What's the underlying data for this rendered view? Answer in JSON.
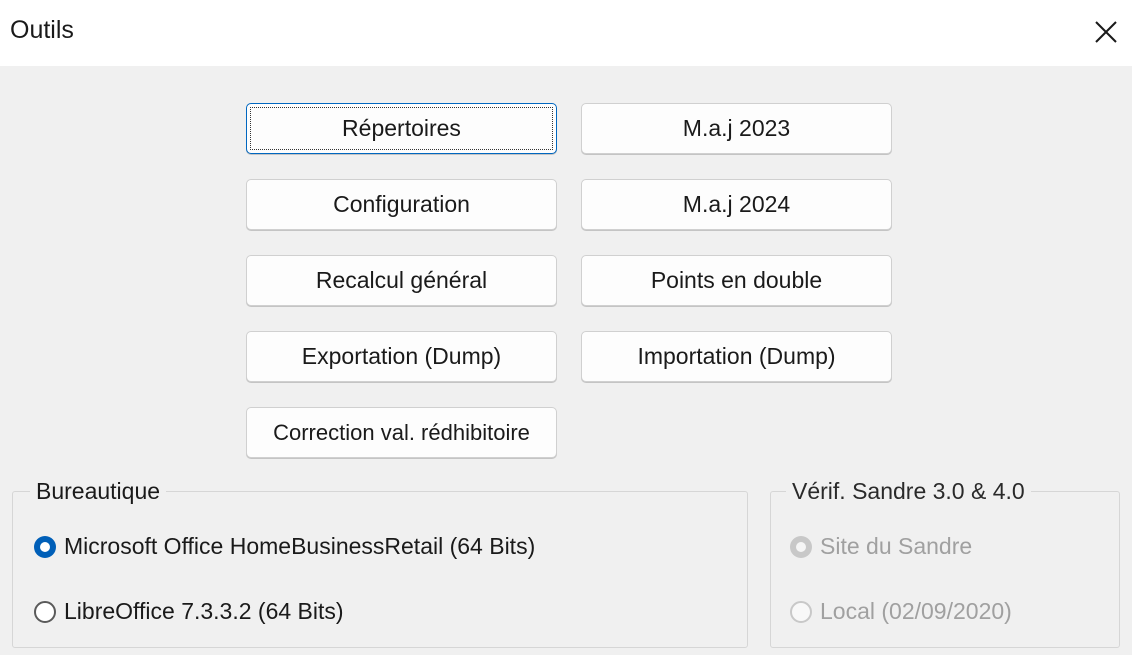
{
  "window": {
    "title": "Outils"
  },
  "buttons": {
    "repertoires": "Répertoires",
    "maj2023": "M.a.j 2023",
    "configuration": "Configuration",
    "maj2024": "M.a.j 2024",
    "recalcul": "Recalcul général",
    "points_double": "Points en double",
    "exportation": "Exportation (Dump)",
    "importation": "Importation (Dump)",
    "correction": "Correction val. rédhibitoire"
  },
  "bureautique": {
    "legend": "Bureautique",
    "options": [
      {
        "label": "Microsoft Office HomeBusinessRetail (64 Bits)",
        "checked": true
      },
      {
        "label": "LibreOffice 7.3.3.2 (64 Bits)",
        "checked": false
      }
    ]
  },
  "sandre": {
    "legend": "Vérif. Sandre 3.0 & 4.0",
    "options": [
      {
        "label": "Site du Sandre",
        "checked": true,
        "disabled": true
      },
      {
        "label": "Local (02/09/2020)",
        "checked": false,
        "disabled": true
      }
    ]
  },
  "colors": {
    "accent": "#005fb8",
    "focus_border": "#0067c0",
    "disabled_text": "#a0a0a0",
    "window_bg": "#f0f0f0"
  },
  "icons": {
    "close": "close-icon"
  }
}
